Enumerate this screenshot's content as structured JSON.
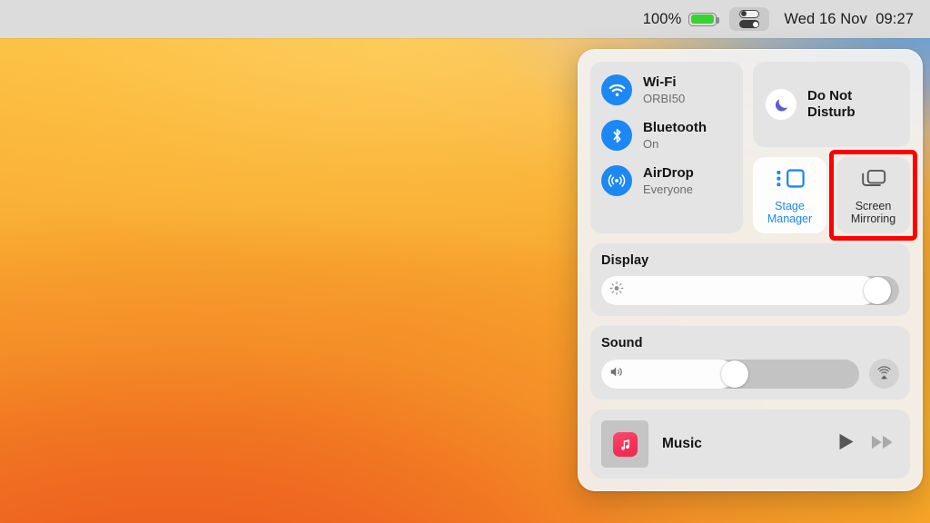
{
  "menubar": {
    "battery_percent": "100%",
    "battery_level": 100,
    "battery_color": "#37d331",
    "control_center_icon": "control-center-toggles-icon",
    "clock": "Wed 16 Nov  09:27"
  },
  "control_center": {
    "connectivity": [
      {
        "icon": "wifi-icon",
        "title": "Wi-Fi",
        "subtitle": "ORBI50",
        "accent": "#1c88f4"
      },
      {
        "icon": "bluetooth-icon",
        "title": "Bluetooth",
        "subtitle": "On",
        "accent": "#1c88f4"
      },
      {
        "icon": "airdrop-icon",
        "title": "AirDrop",
        "subtitle": "Everyone",
        "accent": "#1c88f4"
      }
    ],
    "do_not_disturb": {
      "icon": "moon-icon",
      "label_line1": "Do Not",
      "label_line2": "Disturb",
      "accent": "#5b5bd6"
    },
    "stage_manager": {
      "icon": "stage-manager-icon",
      "label_line1": "Stage",
      "label_line2": "Manager",
      "state": "active",
      "accent": "#1c88f4"
    },
    "screen_mirroring": {
      "icon": "screen-mirroring-icon",
      "label_line1": "Screen",
      "label_line2": "Mirroring",
      "state": "inactive",
      "highlight_color": "#fe0000"
    },
    "display": {
      "title": "Display",
      "icon": "brightness-icon",
      "value": 97
    },
    "sound": {
      "title": "Sound",
      "icon": "volume-icon",
      "value": 52,
      "airplay_icon": "airplay-audio-icon"
    },
    "music": {
      "icon": "music-app-icon",
      "name": "Music",
      "play_icon": "play-icon",
      "forward_icon": "fast-forward-icon"
    }
  }
}
